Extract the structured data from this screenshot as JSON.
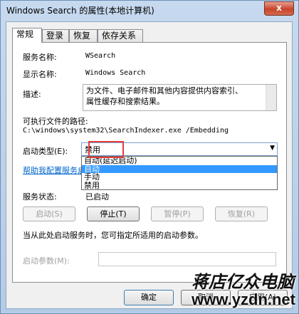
{
  "window": {
    "title": "Windows Search 的属性(本地计算机)",
    "close_glyph": "x"
  },
  "tabs": [
    {
      "label": "常规"
    },
    {
      "label": "登录"
    },
    {
      "label": "恢复"
    },
    {
      "label": "依存关系"
    }
  ],
  "general": {
    "service_name_label": "服务名称:",
    "service_name_value": "WSearch",
    "display_name_label": "显示名称:",
    "display_name_value": "Windows Search",
    "description_label": "描述:",
    "description_line1": "为文件、电子邮件和其他内容提供内容索引、",
    "description_line2": "属性缓存和搜索结果。",
    "path_label": "可执行文件的路径:",
    "path_value": "C:\\windows\\system32\\SearchIndexer.exe /Embedding",
    "startup_type_label": "启动类型(E):",
    "startup_type_value": "禁用",
    "startup_options": [
      "自动(延迟启动)",
      "自动",
      "手动",
      "禁用"
    ],
    "help_link": "帮助我配置服务启动",
    "service_status_label": "服务状态:",
    "service_status_value": "已启动",
    "start_button": "启动(S)",
    "stop_button": "停止(T)",
    "pause_button": "暂停(P)",
    "resume_button": "恢复(R)",
    "hint_text": "当从此处启动服务时，您可指定所适用的启动参数。",
    "start_params_label": "启动参数(M):"
  },
  "footer": {
    "ok": "确定",
    "cancel": "取消",
    "apply": "应用(A)"
  },
  "watermark": {
    "text": "蒋店亿众电脑",
    "url": "www.yzdn.net"
  }
}
